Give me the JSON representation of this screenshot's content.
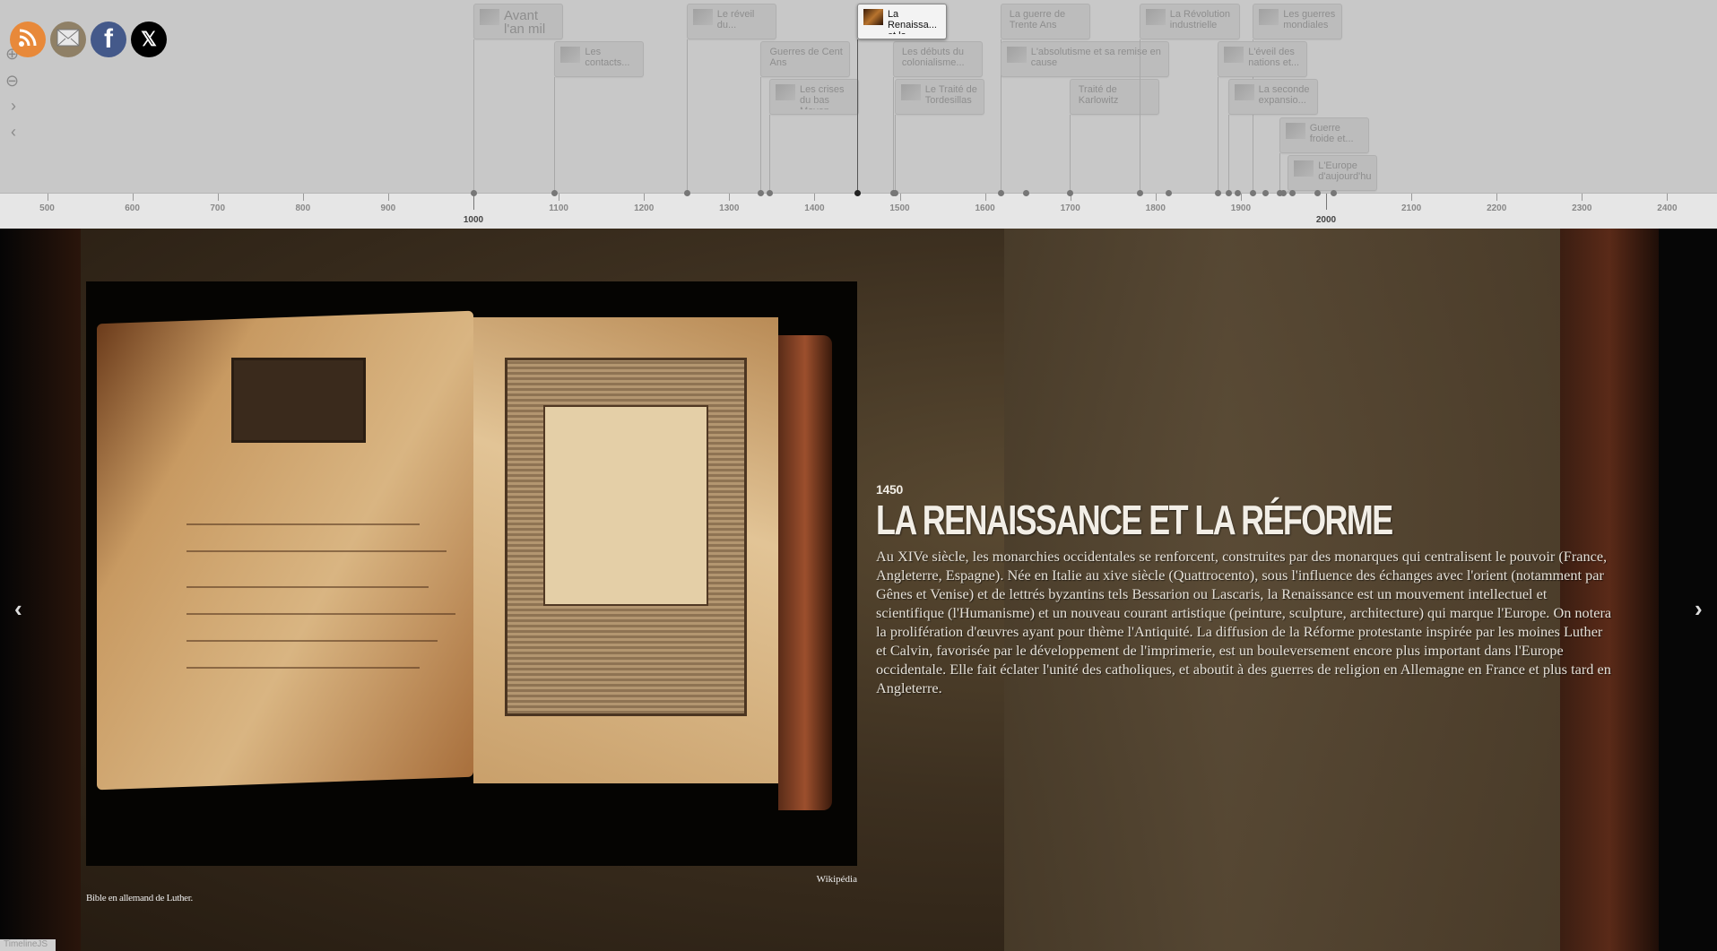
{
  "social": [
    {
      "name": "rss",
      "icon": "rss-icon",
      "color": "#e8893a"
    },
    {
      "name": "email",
      "icon": "envelope-icon",
      "color": "#8f8066"
    },
    {
      "name": "facebook",
      "icon": "facebook-icon",
      "color": "#44598a",
      "glyph": "f"
    },
    {
      "name": "x",
      "icon": "x-logo-icon",
      "color": "#000000",
      "glyph": "𝕏"
    }
  ],
  "tools": {
    "zoom_in": "⊕",
    "zoom_out": "⊖",
    "next": "›",
    "prev": "‹"
  },
  "timeline": {
    "axis_labels": [
      500,
      600,
      700,
      800,
      900,
      1000,
      1100,
      1200,
      1300,
      1400,
      1500,
      1600,
      1700,
      1800,
      1900,
      2000,
      2100,
      2200,
      2300,
      2400
    ],
    "major_labels": [
      1000,
      2000
    ],
    "event_years": [
      1000,
      1095,
      1250,
      1337,
      1347,
      1450,
      1492,
      1494,
      1618,
      1648,
      1699,
      1781,
      1815,
      1873,
      1885,
      1896,
      1914,
      1929,
      1945,
      1950,
      1960,
      1989,
      2008
    ],
    "active_year": 1450,
    "cards": [
      {
        "label": "Avant l'an mil",
        "year": 1000,
        "row": 0,
        "thumb": true,
        "big": true
      },
      {
        "label": "Les contacts...",
        "year": 1095,
        "row": 1,
        "thumb": true
      },
      {
        "label": "Le réveil du...",
        "year": 1250,
        "row": 0,
        "thumb": true
      },
      {
        "label": "Guerres de Cent Ans",
        "year": 1337,
        "row": 1,
        "thumb": false
      },
      {
        "label": "Les crises du bas Moyen...",
        "year": 1347,
        "row": 2,
        "thumb": true
      },
      {
        "label": "La Renaissa... et la...",
        "year": 1450,
        "row": 0,
        "thumb": true,
        "active": true
      },
      {
        "label": "Les débuts du colonialisme...",
        "year": 1492,
        "row": 1,
        "thumb": false
      },
      {
        "label": "Le Traité de Tordesillas",
        "year": 1494,
        "row": 2,
        "thumb": true
      },
      {
        "label": "La guerre de Trente Ans",
        "year": 1618,
        "row": 0,
        "thumb": false
      },
      {
        "label": "L'absolutisme et sa remise en cause",
        "year": 1618,
        "row": 1,
        "thumb": true,
        "wide": true
      },
      {
        "label": "Traité de Karlowitz",
        "year": 1699,
        "row": 2,
        "thumb": false
      },
      {
        "label": "La Révolution industrielle",
        "year": 1781,
        "row": 0,
        "thumb": true
      },
      {
        "label": "Les guerres mondiales",
        "year": 1914,
        "row": 0,
        "thumb": true
      },
      {
        "label": "L'éveil des nations et...",
        "year": 1873,
        "row": 1,
        "thumb": true
      },
      {
        "label": "La seconde expansio...",
        "year": 1885,
        "row": 2,
        "thumb": true
      },
      {
        "label": "Guerre froide et...",
        "year": 1945,
        "row": 3,
        "thumb": true
      },
      {
        "label": "L'Europe d'aujourd'hui",
        "year": 1955,
        "row": 4,
        "thumb": true
      }
    ]
  },
  "slide": {
    "year": "1450",
    "title": "LA RENAISSANCE ET LA RÉFORME",
    "body": "Au XIVe siècle, les monarchies occidentales se renforcent, construites par des monarques qui centralisent le pouvoir (France, Angleterre, Espagne). Née en Italie au xive siècle (Quattrocento), sous l'influence des échanges avec l'orient (notamment par Gênes et Venise) et de lettrés byzantins tels Bessarion ou Lascaris, la Renaissance est un mouvement intellectuel et scientifique (l'Humanisme) et un nouveau courant artistique (peinture, sculpture, architecture) qui marque l'Europe. On notera la prolifération d'œuvres ayant pour thème l'Antiquité. La diffusion de la Réforme protestante inspirée par les moines Luther et Calvin, favorisée par le développement de l'imprimerie, est un bouleversement encore plus important dans l'Europe occidentale. Elle fait éclater l'unité des catholiques, et aboutit à des guerres de religion en Allemagne en France et plus tard en Angleterre.",
    "caption": "Bible en allemand de Luther.",
    "credit": "Wikipédia",
    "prev_arrow": "‹",
    "next_arrow": "›"
  },
  "badge": "TimelineJS"
}
